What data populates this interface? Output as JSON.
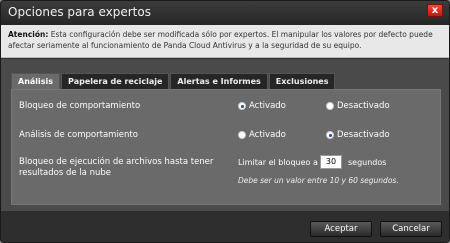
{
  "window": {
    "title": "Opciones para expertos",
    "close_label": "x"
  },
  "notice": {
    "heading": "Atención:",
    "text": " Esta configuración debe ser modificada sólo por expertos. El manipular los valores por defecto puede afectar seriamente al funcionamiento de Panda Cloud Antivirus y a la seguridad de su equipo."
  },
  "tabs": [
    {
      "label": "Análisis",
      "active": true
    },
    {
      "label": "Papelera de reciclaje",
      "active": false
    },
    {
      "label": "Alertas e Informes",
      "active": false
    },
    {
      "label": "Exclusiones",
      "active": false
    }
  ],
  "settings": {
    "behavior_blocking": {
      "label": "Bloqueo de comportamiento",
      "option_on": "Activado",
      "option_off": "Desactivado",
      "selected": "on"
    },
    "behavior_analysis": {
      "label": "Análisis de comportamiento",
      "option_on": "Activado",
      "option_off": "Desactivado",
      "selected": "off"
    },
    "cloud_block": {
      "label": "Bloqueo de ejecución de archivos hasta tener resultados de la nube",
      "limit_prefix": "Limitar el bloqueo a",
      "limit_value": "30",
      "limit_unit": "segundos",
      "hint": "Debe ser un valor entre 10 y 60 segundos."
    }
  },
  "footer": {
    "accept_label": "Aceptar",
    "cancel_label": "Cancelar"
  }
}
